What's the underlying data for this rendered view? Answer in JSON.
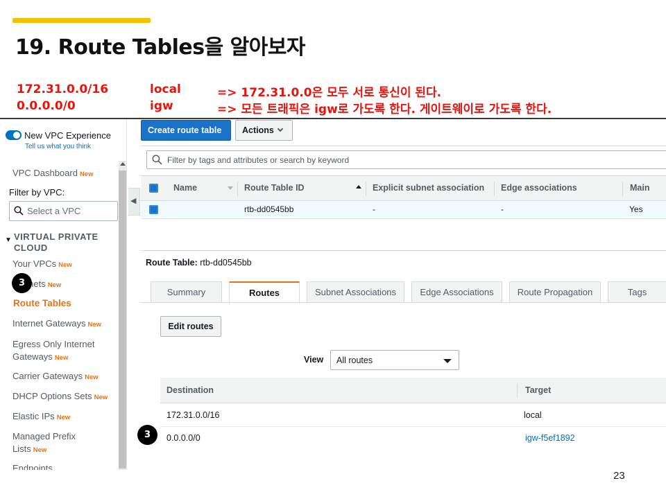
{
  "slide": {
    "title": "19. Route Tables을 알아보자",
    "page_number": "23",
    "accent_color": "#f2c100",
    "notes": [
      {
        "cidr": "172.31.0.0/16",
        "target": "local",
        "desc": "=> 172.31.0.0은 모두 서로 통신이 된다."
      },
      {
        "cidr": "0.0.0.0/0",
        "target": "igw",
        "desc": "=> 모든 트래픽은 igw로 가도록 한다. 게이트웨이로 가도록 한다."
      }
    ],
    "note_color": "#e8140c",
    "badges": [
      "3",
      "3"
    ]
  },
  "sidebar": {
    "new_vpc_experience": "New VPC Experience",
    "tell_us": "Tell us what you think",
    "dashboard": "VPC Dashboard",
    "new_tag": "New",
    "filter_label": "Filter by VPC:",
    "select_placeholder": "Select a VPC",
    "section_title": "VIRTUAL PRIVATE CLOUD",
    "items": [
      {
        "label": "Your VPCs",
        "new": "New"
      },
      {
        "label": "Subnets",
        "new": "New"
      },
      {
        "label": "Route Tables",
        "new": ""
      },
      {
        "label": "Internet Gateways",
        "new": "New"
      },
      {
        "label": "Egress Only Internet Gateways",
        "new": "New"
      },
      {
        "label": "Carrier Gateways",
        "new": "New"
      },
      {
        "label": "DHCP Options Sets",
        "new": "New"
      },
      {
        "label": "Elastic IPs",
        "new": "New"
      },
      {
        "label": "Managed Prefix Lists",
        "new": "New"
      },
      {
        "label": "Endpoints",
        "new": ""
      }
    ],
    "active_color": "#ec7211"
  },
  "toolbar": {
    "create_label": "Create route table",
    "actions_label": "Actions"
  },
  "search": {
    "placeholder": "Filter by tags and attributes or search by keyword"
  },
  "table": {
    "columns": [
      "Name",
      "Route Table ID",
      "Explicit subnet association",
      "Edge associations",
      "Main"
    ],
    "rows": [
      {
        "name": "",
        "id": "rtb-dd0545bb",
        "explicit": "-",
        "edge": "-",
        "main": "Yes"
      }
    ]
  },
  "detail": {
    "label": "Route Table:",
    "value": "rtb-dd0545bb",
    "tabs": [
      "Summary",
      "Routes",
      "Subnet Associations",
      "Edge Associations",
      "Route Propagation",
      "Tags"
    ],
    "active_tab": "Routes",
    "edit_routes_label": "Edit routes",
    "view_label": "View",
    "view_value": "All routes",
    "routes_columns": [
      "Destination",
      "Target"
    ],
    "routes": [
      {
        "destination": "172.31.0.0/16",
        "target": "local"
      },
      {
        "destination": "0.0.0.0/0",
        "target": "igw-f5ef1892"
      }
    ]
  }
}
